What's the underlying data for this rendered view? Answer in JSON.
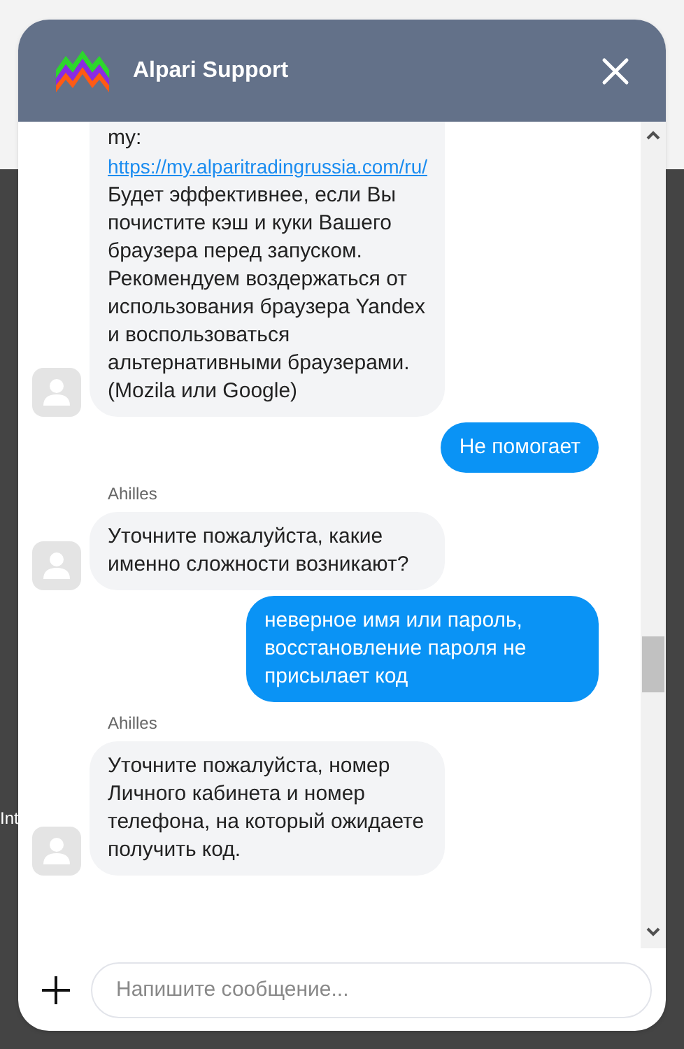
{
  "background": {
    "text": "Int"
  },
  "header": {
    "title": "Alpari Support"
  },
  "messages": [
    {
      "kind": "agent",
      "prefix": "my:",
      "link": "https://my.alparitradingrussia.com/ru/",
      "text": "Будет эффективнее, если Вы почистите кэш и куки Вашего браузера перед запуском. Рекомендуем воздержаться от использования браузера Yandex и воспользоваться альтернативными браузерами. (Mozila или Google)"
    },
    {
      "kind": "user",
      "text": "Не помогает"
    },
    {
      "kind": "agent",
      "author": "Ahilles",
      "text": "Уточните пожалуйста, какие именно сложности возникают?"
    },
    {
      "kind": "user",
      "text": "неверное имя или пароль, восстановление пароля не присылает код"
    },
    {
      "kind": "agent",
      "author": "Ahilles",
      "text": "Уточните пожалуйста, номер Личного кабинета и номер телефона, на который ожидаете получить код."
    }
  ],
  "composer": {
    "placeholder": "Напишите сообщение..."
  }
}
